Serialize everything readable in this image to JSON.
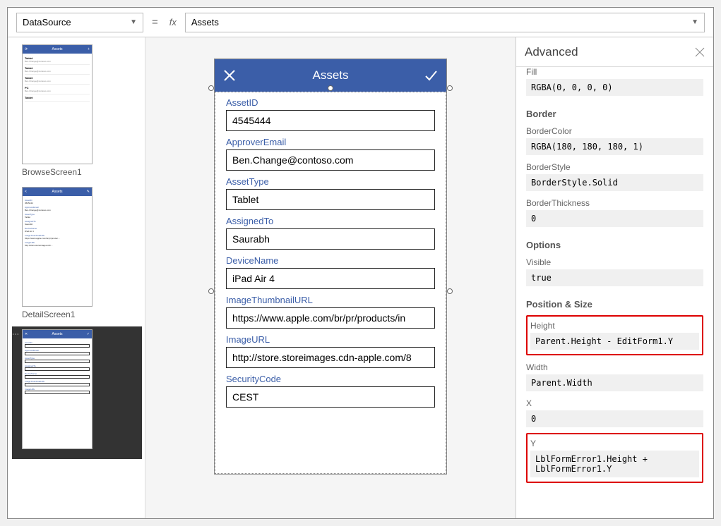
{
  "formula_bar": {
    "property": "DataSource",
    "equals": "=",
    "fx_label": "fx",
    "value": "Assets"
  },
  "sidebar": {
    "screens": [
      {
        "label": "BrowseScreen1",
        "selected": false
      },
      {
        "label": "DetailScreen1",
        "selected": false
      },
      {
        "label": "",
        "selected": true
      }
    ]
  },
  "canvas": {
    "app_header": {
      "title": "Assets",
      "close_icon": "close-icon",
      "accept_icon": "check-icon"
    },
    "fields": [
      {
        "label": "AssetID",
        "value": "4545444"
      },
      {
        "label": "ApproverEmail",
        "value": "Ben.Change@contoso.com"
      },
      {
        "label": "AssetType",
        "value": "Tablet"
      },
      {
        "label": "AssignedTo",
        "value": "Saurabh"
      },
      {
        "label": "DeviceName",
        "value": "iPad Air 4"
      },
      {
        "label": "ImageThumbnailURL",
        "value": "https://www.apple.com/br/pr/products/in"
      },
      {
        "label": "ImageURL",
        "value": "http://store.storeimages.cdn-apple.com/8"
      },
      {
        "label": "SecurityCode",
        "value": "CEST"
      }
    ]
  },
  "right_panel": {
    "title": "Advanced",
    "fill_label": "Fill",
    "fill_value": "RGBA(0, 0, 0, 0)",
    "border_section": "Border",
    "border_color_label": "BorderColor",
    "border_color_value": "RGBA(180, 180, 180, 1)",
    "border_style_label": "BorderStyle",
    "border_style_value": "BorderStyle.Solid",
    "border_thickness_label": "BorderThickness",
    "border_thickness_value": "0",
    "options_section": "Options",
    "visible_label": "Visible",
    "visible_value": "true",
    "position_section": "Position & Size",
    "height_label": "Height",
    "height_value": "Parent.Height - EditForm1.Y",
    "width_label": "Width",
    "width_value": "Parent.Width",
    "x_label": "X",
    "x_value": "0",
    "y_label": "Y",
    "y_value": "LblFormError1.Height + LblFormError1.Y"
  },
  "thumbs": {
    "browse_title": "Assets",
    "item1_t": "Tablet",
    "item1_s": "Ben.Change@contoso.com",
    "item2_t": "Tablet",
    "item2_s": "Ben.Change@contoso.com",
    "item3_t": "Tablet",
    "item3_s": "Ben.Change@contoso.com",
    "item4_t": "PC",
    "item4_s": "Ben.Change@contoso.com",
    "item5_t": "Tablet",
    "detail_title": "Assets",
    "d_assetid_l": "AssetID",
    "d_assetid_v": "4545444",
    "d_appr_l": "ApproverEmail",
    "d_appr_v": "Ben.Change@contoso.com",
    "d_type_l": "AssetType",
    "d_type_v": "Tablet",
    "d_assign_l": "AssignedTo",
    "d_assign_v": "Saurabh",
    "d_dev_l": "DeviceName",
    "d_dev_v": "iPad Air 4",
    "d_thumb_l": "ImageThumbnailURL",
    "d_thumb_v": "https://www.apple.com/br/pr/produc...",
    "d_url_l": "ImageURL",
    "d_url_v": "http://store.storeimages.cdn...",
    "edit_title": "Assets"
  }
}
